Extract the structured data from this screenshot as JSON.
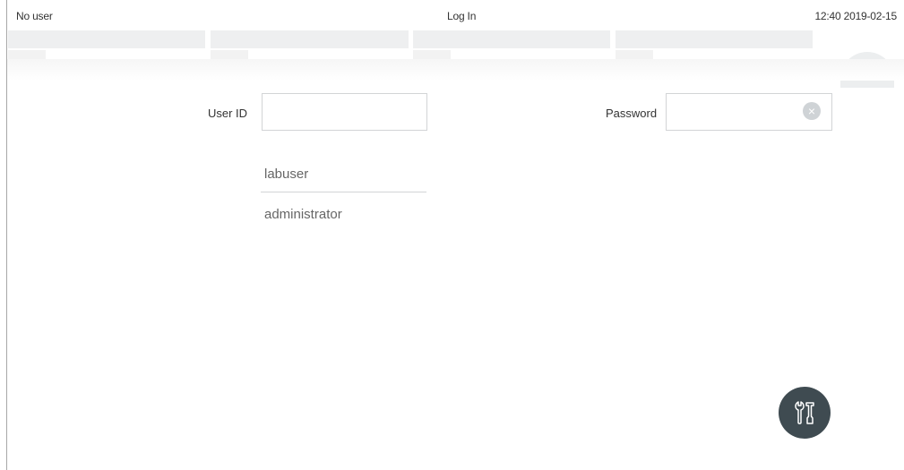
{
  "status_bar": {
    "user": "No user",
    "title": "Log In",
    "datetime": "12:40 2019-02-15"
  },
  "login": {
    "user_id_label": "User ID",
    "user_id_value": "",
    "password_label": "Password",
    "password_value": "",
    "clear_icon": "clear-icon"
  },
  "user_list": [
    {
      "label": "labuser"
    },
    {
      "label": "administrator"
    }
  ],
  "tools_button": {
    "icon": "tools-icon"
  },
  "colors": {
    "tools_button_bg": "#3f4b51",
    "border": "#d2d4d6",
    "clear_icon_bg": "#cfd3d6"
  }
}
